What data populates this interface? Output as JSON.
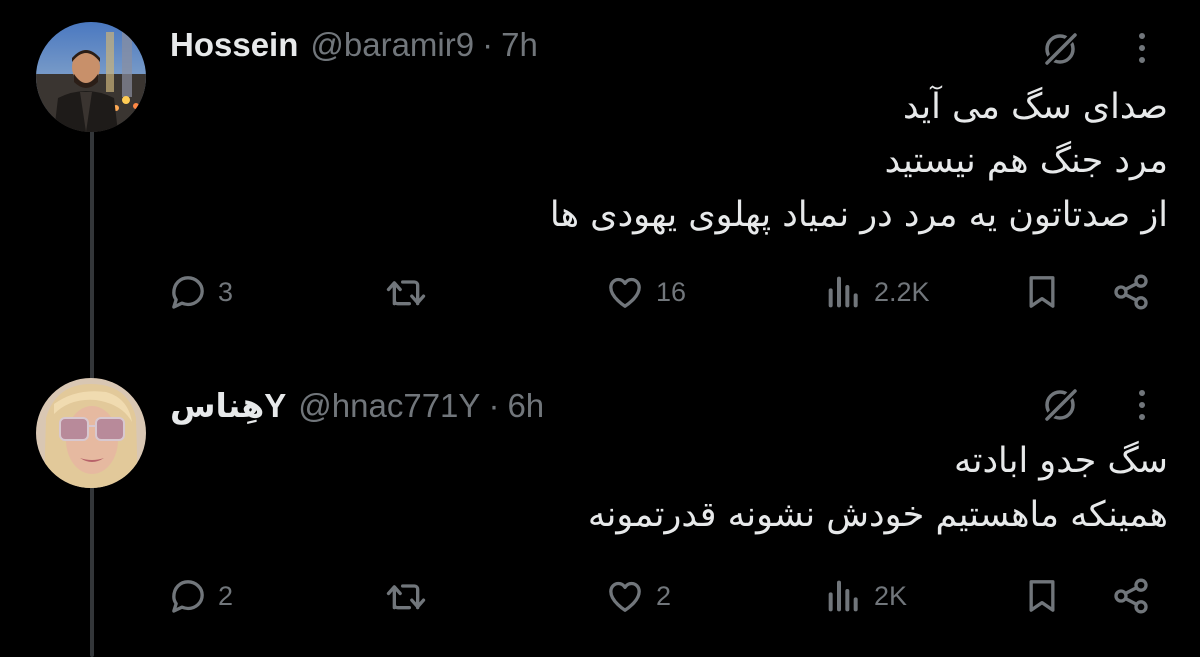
{
  "tweets": [
    {
      "display_name": "Hossein",
      "handle": "@baramir9",
      "separator": "·",
      "time": "7h",
      "lines": [
        "صدای سگ می آید",
        "مرد جنگ هم نیستید",
        "از صدتاتون یه مرد در نمیاد پهلوی یهودی ها"
      ],
      "replies": "3",
      "retweets": "",
      "likes": "16",
      "views": "2.2K"
    },
    {
      "display_name": "هِناسY",
      "handle": "@hnac771Y",
      "separator": "·",
      "time": "6h",
      "lines": [
        "سگ جدو ابادته",
        "همینکه ماهستیم خودش نشونه قدرتمونه"
      ],
      "replies": "2",
      "retweets": "",
      "likes": "2",
      "views": "2K"
    }
  ],
  "colors": {
    "background": "#000000",
    "text_primary": "#e7e9ea",
    "text_secondary": "#71767b",
    "thread_line": "#333639"
  },
  "icons": {
    "reply": "reply-icon",
    "retweet": "retweet-icon",
    "like": "heart-icon",
    "views": "views-chart-icon",
    "bookmark": "bookmark-icon",
    "share": "share-icon",
    "grok": "grok-icon",
    "more": "more-vertical-icon"
  }
}
